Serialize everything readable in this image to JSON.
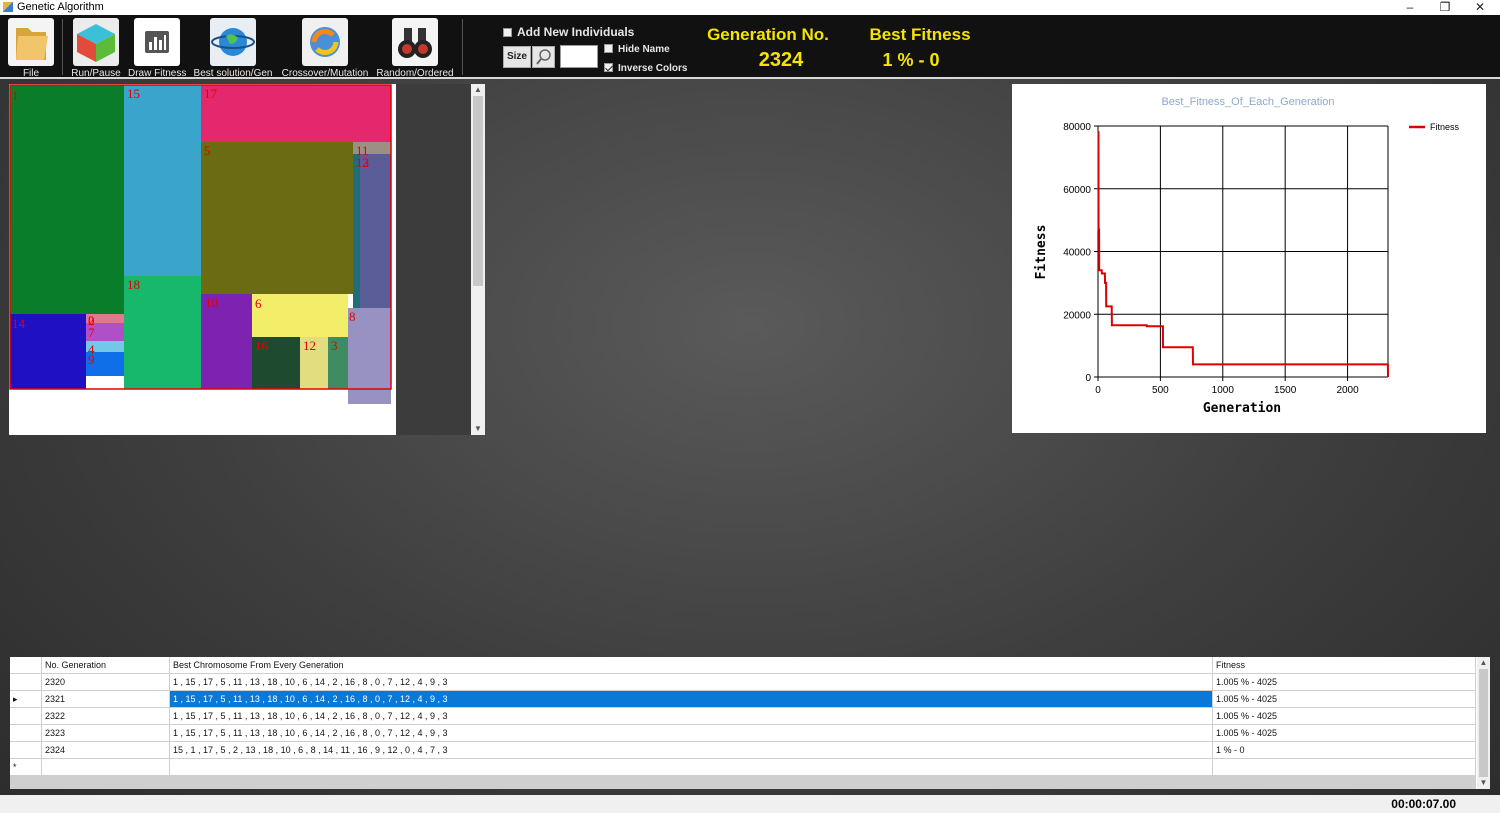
{
  "window": {
    "title": "Genetic Algorithm",
    "minimize": "–",
    "maximize": "❐",
    "close": "✕"
  },
  "toolbar": [
    {
      "label": "File",
      "icon": "folder-icon"
    },
    {
      "label": "Run/Pause",
      "icon": "cube-icon"
    },
    {
      "label": "Draw Fitness",
      "icon": "bar-chart-icon"
    },
    {
      "label": "Best solution/Gen",
      "icon": "globe-icon"
    },
    {
      "label": "Crossover/Mutation",
      "icon": "refresh-icon"
    },
    {
      "label": "Random/Ordered",
      "icon": "binoculars-icon"
    }
  ],
  "options": {
    "add_new_individuals": {
      "label": "Add New Individuals",
      "checked": false
    },
    "size_label": "Size",
    "size_value": "",
    "hide_name": {
      "label": "Hide Name",
      "checked": false
    },
    "inverse_colors": {
      "label": "Inverse Colors",
      "checked": true
    }
  },
  "header": {
    "generation_label": "Generation No.",
    "generation_value": "2324",
    "fitness_label": "Best Fitness",
    "fitness_value": "1 %  -  0"
  },
  "layout_labels": [
    "1",
    "15",
    "17",
    "5",
    "11",
    "13",
    "18",
    "10",
    "6",
    "14",
    "2",
    "16",
    "8",
    "0",
    "7",
    "12",
    "4",
    "9",
    "3"
  ],
  "layout_colors": {
    "p1": "#0a7d2a",
    "p15": "#3aa4cc",
    "p17": "#e5286e",
    "p5": "#6a6b12",
    "p11": "#9e8f84",
    "p13": "#1f6e78",
    "p12side": "#5a5d98",
    "p18": "#17b86c",
    "p10": "#7e22b2",
    "p6": "#f2ee6a",
    "p14": "#2010c4",
    "p2": "#e07890",
    "p7": "#b050c8",
    "p4": "#73c7e8",
    "p9": "#0f6fe8",
    "p16": "#1e4a30",
    "p12": "#e2dd7e",
    "p3": "#3f8b62",
    "p8": "#9792c2",
    "border": "#e60000",
    "label": "#e60000"
  },
  "chart_data": {
    "type": "line",
    "title": "Best_Fitness_Of_Each_Generation",
    "xlabel": "Generation",
    "ylabel": "Fitness",
    "xlim": [
      0,
      2324
    ],
    "ylim": [
      0,
      80000
    ],
    "xticks": [
      0,
      500,
      1000,
      1500,
      2000
    ],
    "yticks": [
      0,
      20000,
      40000,
      60000,
      80000
    ],
    "grid": true,
    "legend": "top-right",
    "series": [
      {
        "name": "Fitness",
        "color": "#dd0000",
        "points": [
          [
            0,
            78000
          ],
          [
            4,
            78000
          ],
          [
            5,
            47000
          ],
          [
            9,
            47000
          ],
          [
            10,
            34000
          ],
          [
            30,
            34000
          ],
          [
            31,
            33000
          ],
          [
            55,
            33000
          ],
          [
            56,
            30000
          ],
          [
            65,
            30000
          ],
          [
            66,
            22500
          ],
          [
            110,
            22500
          ],
          [
            111,
            16500
          ],
          [
            390,
            16500
          ],
          [
            391,
            16200
          ],
          [
            520,
            16200
          ],
          [
            521,
            9500
          ],
          [
            760,
            9500
          ],
          [
            761,
            4025
          ],
          [
            2323,
            4025
          ],
          [
            2324,
            0
          ]
        ]
      }
    ]
  },
  "grid": {
    "headers": [
      "No. Generation",
      "Best Chromosome From Every Generation",
      "Fitness"
    ],
    "rows": [
      {
        "gen": "2320",
        "chromosome": "1 , 15 , 17 , 5 , 11 , 13 , 18 , 10 , 6 , 14 , 2 , 16 , 8 , 0 , 7 , 12 , 4 , 9 , 3",
        "fitness": "1.005 %  -  4025",
        "selected": false
      },
      {
        "gen": "2321",
        "chromosome": "1 , 15 , 17 , 5 , 11 , 13 , 18 , 10 , 6 , 14 , 2 , 16 , 8 , 0 , 7 , 12 , 4 , 9 , 3",
        "fitness": "1.005 %  -  4025",
        "selected": true
      },
      {
        "gen": "2322",
        "chromosome": "1 , 15 , 17 , 5 , 11 , 13 , 18 , 10 , 6 , 14 , 2 , 16 , 8 , 0 , 7 , 12 , 4 , 9 , 3",
        "fitness": "1.005 %  -  4025",
        "selected": false
      },
      {
        "gen": "2323",
        "chromosome": "1 , 15 , 17 , 5 , 11 , 13 , 18 , 10 , 6 , 14 , 2 , 16 , 8 , 0 , 7 , 12 , 4 , 9 , 3",
        "fitness": "1.005 %  -  4025",
        "selected": false
      },
      {
        "gen": "2324",
        "chromosome": "15 , 1 , 17 , 5 , 2 , 13 , 18 , 10 , 6 , 8 , 14 , 11 , 16 , 9 , 12 , 0 , 4 , 7 , 3",
        "fitness": "1 %  -  0",
        "selected": false
      }
    ],
    "new_row_marker": "*",
    "selected_marker": "▸"
  },
  "status": {
    "timer": "00:00:07.00"
  }
}
